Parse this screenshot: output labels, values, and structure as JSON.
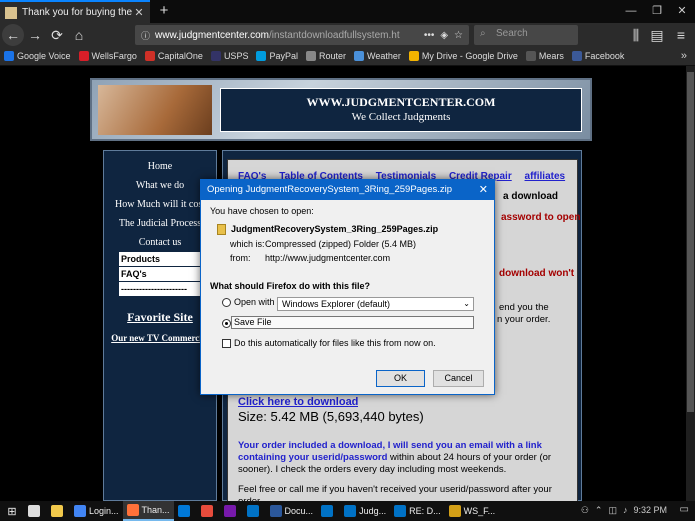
{
  "browser": {
    "tab_title": "Thank you for buying the Judgm",
    "url_domain": "www.judgmentcenter.com",
    "url_path": "/instantdownloadfullsystem.ht",
    "search_placeholder": "Search",
    "bookmarks": [
      {
        "label": "Google Voice",
        "color": "#1a73e8"
      },
      {
        "label": "WellsFargo",
        "color": "#d71e28"
      },
      {
        "label": "CapitalOne",
        "color": "#d03027"
      },
      {
        "label": "USPS",
        "color": "#333366"
      },
      {
        "label": "PayPal",
        "color": "#009cde"
      },
      {
        "label": "Router",
        "color": "#888888"
      },
      {
        "label": "Weather",
        "color": "#4a90d9"
      },
      {
        "label": "My Drive - Google Drive",
        "color": "#f4b400"
      },
      {
        "label": "Mears",
        "color": "#555555"
      },
      {
        "label": "Facebook",
        "color": "#3b5998"
      }
    ]
  },
  "site": {
    "banner_title": "WWW.JUDGMENTCENTER.COM",
    "banner_subtitle": "We Collect Judgments",
    "nav": [
      "Home",
      "What we do",
      "How Much will it cost",
      "The Judicial Process",
      "Contact us"
    ],
    "nav_white": [
      "Products",
      "FAQ's",
      "----------------------"
    ],
    "favorite_site": "Favorite Site",
    "tv_commercial": "Our new TV Commercial",
    "top_links": [
      "FAQ's",
      "Table of Contents",
      "Testimonials",
      "Credit Repair",
      "affiliates"
    ],
    "frag_download": "a download",
    "frag_password": "assword to open",
    "frag_wont": "download won't",
    "frag_send": "end you the",
    "frag_order": "n your order.",
    "download_link": "Click here to download",
    "size_text": "Size: 5.42 MB (5,693,440 bytes)",
    "order_blue_1": "Your order included a download, I will send you an email with a link containing your userid/password",
    "order_black_1": " within about 24 hours of your order (or sooner). I check the orders every day including most weekends.",
    "order_2": "Feel free or call me if you haven't received your userid/password after your order."
  },
  "dialog": {
    "title": "Opening JudgmentRecoverySystem_3Ring_259Pages.zip",
    "chosen": "You have chosen to open:",
    "filename": "JudgmentRecoverySystem_3Ring_259Pages.zip",
    "which_is_label": "which is:",
    "which_is_value": "Compressed (zipped) Folder (5.4 MB)",
    "from_label": "from:",
    "from_value": "http://www.judgmentcenter.com",
    "question": "What should Firefox do with this file?",
    "open_with_label": "Open with",
    "open_with_value": "Windows Explorer (default)",
    "save_file_label": "Save File",
    "auto_label": "Do this automatically for files like this from now on.",
    "ok": "OK",
    "cancel": "Cancel"
  },
  "taskbar": {
    "items": [
      {
        "label": "",
        "color": "#ffffff"
      },
      {
        "label": "",
        "color": "#dddddd"
      },
      {
        "label": "",
        "color": "#f2c94c"
      },
      {
        "label": "Login...",
        "color": "#4285f4",
        "active": false
      },
      {
        "label": "Than...",
        "color": "#ff7139",
        "active": true
      },
      {
        "label": "",
        "color": "#0078d7"
      },
      {
        "label": "",
        "color": "#e74c3c"
      },
      {
        "label": "",
        "color": "#7719aa"
      },
      {
        "label": "",
        "color": "#0072c6"
      },
      {
        "label": "Docu...",
        "color": "#2b579a",
        "active": false
      },
      {
        "label": "",
        "color": "#0072c6"
      },
      {
        "label": "Judg...",
        "color": "#0072c6",
        "active": false
      },
      {
        "label": "RE: D...",
        "color": "#0072c6",
        "active": false
      },
      {
        "label": "WS_F...",
        "color": "#d4a017",
        "active": false
      }
    ],
    "clock": "9:32 PM"
  }
}
